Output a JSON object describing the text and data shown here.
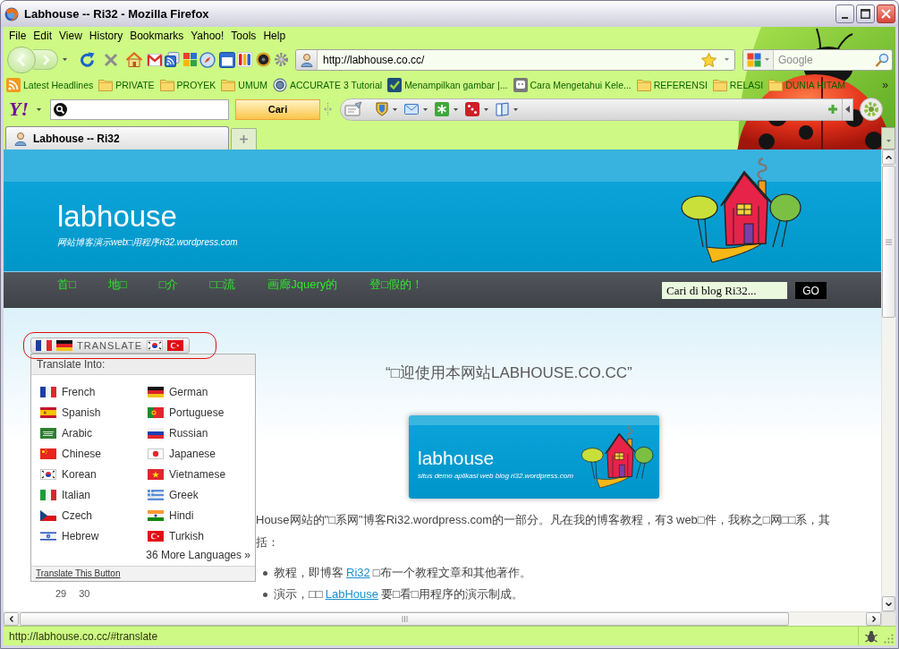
{
  "window": {
    "title": "Labhouse -- Ri32 - Mozilla Firefox"
  },
  "menu_bar": [
    "File",
    "Edit",
    "View",
    "History",
    "Bookmarks",
    "Yahoo!",
    "Tools",
    "Help"
  ],
  "navigation_toolbar": {
    "address": "http://labhouse.co.cc/",
    "search_placeholder": "Google"
  },
  "bookmarks_toolbar": {
    "items": [
      {
        "kind": "feed",
        "label": "Latest Headlines"
      },
      {
        "kind": "folder",
        "label": "PRIVATE"
      },
      {
        "kind": "folder",
        "label": "PROYEK"
      },
      {
        "kind": "folder",
        "label": "UMUM"
      },
      {
        "kind": "wordpress",
        "label": "ACCURATE 3 Tutorial"
      },
      {
        "kind": "check",
        "label": "Menampilkan gambar |..."
      },
      {
        "kind": "page",
        "label": "Cara Mengetahui Kele..."
      },
      {
        "kind": "folder",
        "label": "REFERENSI"
      },
      {
        "kind": "folder",
        "label": "RELASI"
      },
      {
        "kind": "folder",
        "label": "DUNIA HITAM"
      }
    ],
    "overflow": "»"
  },
  "yahoo_toolbar": {
    "logo": "Y!",
    "search_button": "Cari"
  },
  "tabs": [
    {
      "label": "Labhouse -- Ri32",
      "selected": true
    }
  ],
  "page": {
    "header": {
      "title": "labhouse",
      "tagline": "网站博客演示web□用程序ri32.wordpress.com"
    },
    "nav": [
      "首□",
      "地□",
      "□介",
      "□□流",
      "画廊Jquery的",
      "登□假的！"
    ],
    "search": {
      "value": "Cari di blog Ri32...",
      "button": "GO"
    },
    "translate": {
      "button": "TRANSLATE",
      "menu_title": "Translate Into:",
      "languages": [
        "French",
        "German",
        "Spanish",
        "Portuguese",
        "Arabic",
        "Russian",
        "Chinese",
        "Japanese",
        "Korean",
        "Vietnamese",
        "Italian",
        "Greek",
        "Czech",
        "Hindi",
        "Hebrew",
        "Turkish"
      ],
      "more": "36 More Languages »",
      "footer": "Translate This Button"
    },
    "welcome": "“□迎使用本网站LABHOUSE.CO.CC”",
    "banner": {
      "title": "labhouse",
      "tagline": "situs demo aplikasi web blog ri32.wordpress.com"
    },
    "intro_lines": [
      "House网站的\"□系网\"博客Ri32.wordpress.com的一部分。凡在我的博客教程，有3 web□件，我称之□网□□系，其",
      "括："
    ],
    "list": [
      {
        "text": "教程，即博客",
        "link": "Ri32",
        "rest": "□布一个教程文章和其他著作。"
      },
      {
        "text": "演示，□□",
        "link": "LabHouse",
        "rest": "要□看□用程序的演示制成。"
      }
    ],
    "calendar": [
      "29",
      "30"
    ]
  },
  "status_bar": {
    "text": "http://labhouse.co.cc/#translate"
  }
}
